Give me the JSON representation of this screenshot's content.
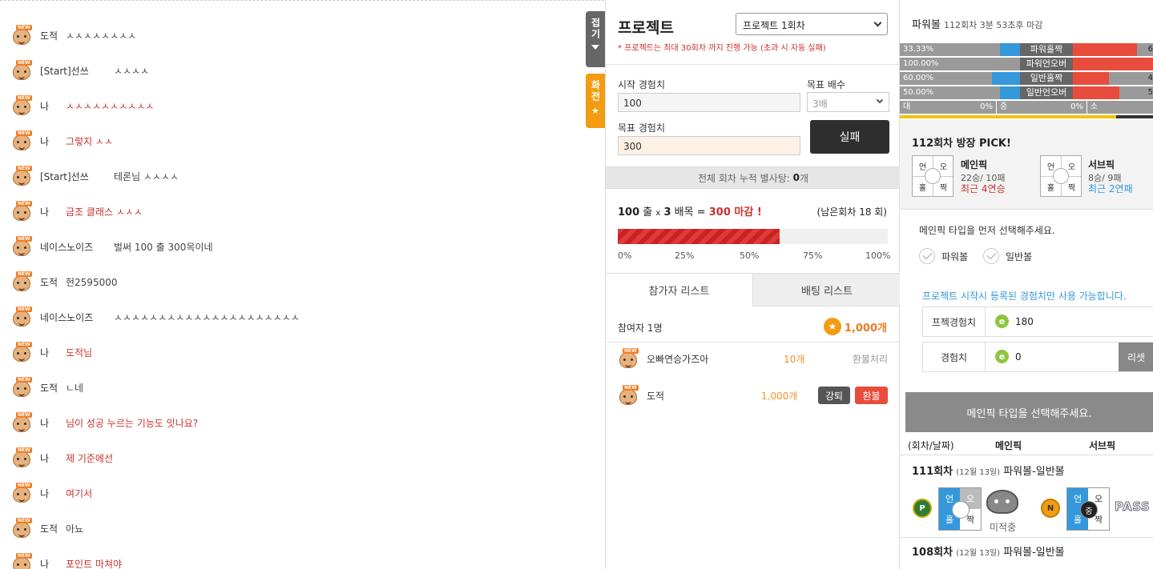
{
  "chat": {
    "messages": [
      {
        "user": "도적",
        "text": "ㅅㅅㅅㅅㅅㅅㅅㅅ",
        "me": false
      },
      {
        "user": "[Start]선쓰",
        "text": "ㅅㅅㅅㅅ",
        "me": false
      },
      {
        "user": "나",
        "text": "ㅅㅅㅅㅅㅅㅅㅅㅅㅅㅅ",
        "me": true
      },
      {
        "user": "나",
        "text": "그렇지 ㅅㅅ",
        "me": true
      },
      {
        "user": "[Start]선쓰",
        "text": "테론님 ㅅㅅㅅㅅ",
        "me": false
      },
      {
        "user": "나",
        "text": "금조 클래스 ㅅㅅㅅ",
        "me": true
      },
      {
        "user": "네이스노이즈",
        "text": "벌써 100 출 300목이네",
        "me": false
      },
      {
        "user": "도적",
        "text": "현2595000",
        "me": false
      },
      {
        "user": "네이스노이즈",
        "text": "ㅅㅅㅅㅅㅅㅅㅅㅅㅅㅅㅅㅅㅅㅅㅅㅅㅅㅅㅅㅅㅅ",
        "me": false
      },
      {
        "user": "나",
        "text": "도적님",
        "me": true
      },
      {
        "user": "도적",
        "text": "ㄴ네",
        "me": false
      },
      {
        "user": "나",
        "text": "님이 성공 누르는 기능도 잇나요?",
        "me": true
      },
      {
        "user": "나",
        "text": "제 기준에선",
        "me": true
      },
      {
        "user": "나",
        "text": "여기서",
        "me": true
      },
      {
        "user": "도적",
        "text": "아뇨",
        "me": false
      },
      {
        "user": "나",
        "text": "포인트 마쳐야",
        "me": true
      }
    ],
    "new_badge": "NEW"
  },
  "side_tabs": {
    "fold_label": "접기",
    "fullscreen_label": "화전"
  },
  "project": {
    "title": "프로젝트",
    "round_select": "프로젝트 1회차",
    "note": "* 프로젝트는 최대 30회차 까지 진행 가능 (초과 시 자동 실패)",
    "start_exp_label": "시작 경험치",
    "start_exp_value": "100",
    "multiplier_label": "목표 배수",
    "multiplier_value": "3배",
    "target_exp_label": "목표 경험치",
    "target_exp_value": "300",
    "fail_button": "실패",
    "cumulative_label": "전체 회차 누적 별사탕:",
    "cumulative_value": "0",
    "cumulative_unit": "개",
    "goal": {
      "start": "100",
      "start_unit": "출",
      "x": "x",
      "mult": "3",
      "mult_unit": "배목",
      "eq": "=",
      "target_text": "300 마감 !"
    },
    "remaining": "(남은회차 18 회)",
    "progress_fraction": 0.6,
    "progress_ticks": [
      "0%",
      "25%",
      "50%",
      "75%",
      "100%"
    ],
    "tabs": [
      "참가자 리스트",
      "배팅 리스트"
    ],
    "participants_label": "참여자 1명",
    "total_coins": "1,000개",
    "participants": [
      {
        "name": "오빠연승가즈아",
        "amount": "10개",
        "status": "환불처리"
      },
      {
        "name": "도적",
        "amount": "1,000개",
        "btn_kick": "강퇴",
        "btn_refund": "환불"
      }
    ]
  },
  "powerball": {
    "title": "파워볼",
    "round_info": "112회차 3분 53초후 마감",
    "stats": [
      {
        "left_pct": "33.33%",
        "label": "파워홀짝",
        "blue": 0.5,
        "red": 0.8,
        "right": "6"
      },
      {
        "left_pct": "100.00%",
        "label": "파워언오버",
        "blue": 0.0,
        "red": 1.0,
        "right": ""
      },
      {
        "left_pct": "60.00%",
        "label": "일반홀짝",
        "blue": 0.7,
        "red": 0.45,
        "right": "4"
      },
      {
        "left_pct": "50.00%",
        "label": "일반언오버",
        "blue": 0.5,
        "red": 0.58,
        "right": "5"
      }
    ],
    "dsm": {
      "d": "대",
      "d_pct": "0%",
      "j": "중",
      "j_pct": "0%",
      "s": "소"
    },
    "pick_title": "112회차 방장 PICK!",
    "grid_labels": [
      "언",
      "오",
      "홀",
      "짝"
    ],
    "main_pick": {
      "name": "메인픽",
      "record": "22승/ 10패",
      "streak": "최근 4연승",
      "color": "#c9302c"
    },
    "sub_pick": {
      "name": "서브픽",
      "record": "8승/ 9패",
      "streak": "최근 2연패",
      "color": "#3498db"
    },
    "select_msg": "메인픽 타입을 먼저 선택해주세요.",
    "options": [
      "파워볼",
      "일반볼"
    ],
    "info_msg": "프로젝트 시작시 등록된 경험치만 사용 가능합니다.",
    "exp_rows": [
      {
        "label": "프젝경험치",
        "value": "180"
      },
      {
        "label": "경험치",
        "value": "0",
        "reset": "리셋"
      }
    ],
    "e_icon": "e",
    "gray_bar": "메인픽 타입을 선택해주세요.",
    "history_headers": [
      "(회차/날짜)",
      "메인픽",
      "서브픽"
    ],
    "history": [
      {
        "round": "111회차",
        "date": "(12월 13일)",
        "type": "파워볼-일반볼",
        "p": "P",
        "n": "N",
        "miss": "미적중",
        "pass": "PASS",
        "mid": "중"
      },
      {
        "round": "108회차",
        "date": "(12월 13일)",
        "type": "파워볼-일반볼"
      }
    ]
  }
}
